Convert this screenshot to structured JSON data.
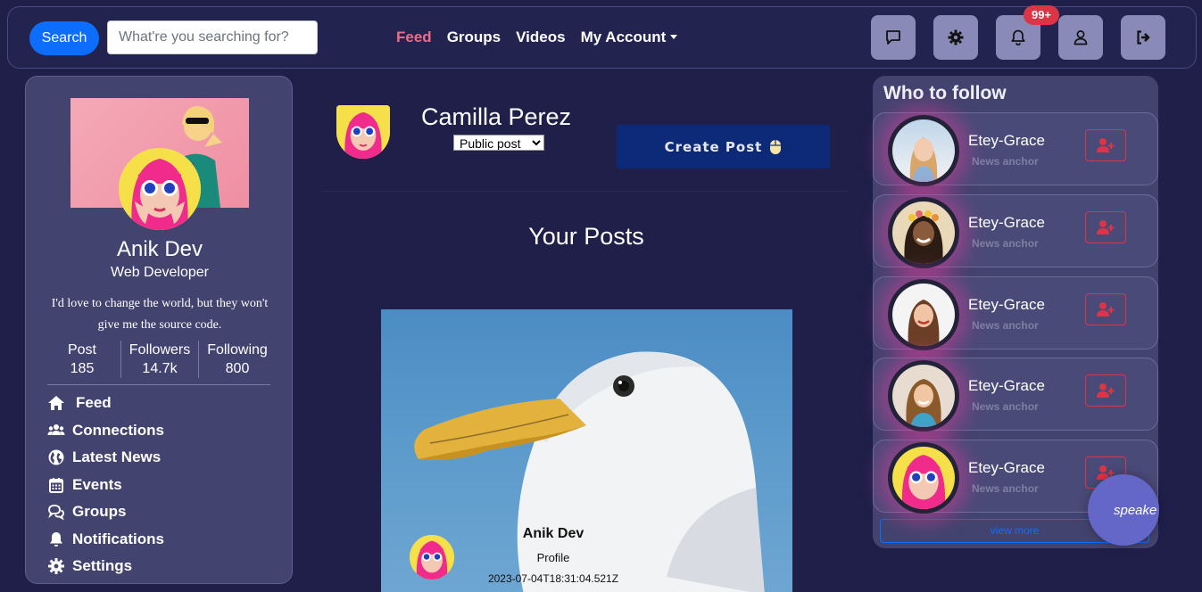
{
  "navbar": {
    "search_label": "Search",
    "search_placeholder": "What're you searching for?",
    "links": [
      "Feed",
      "Groups",
      "Videos",
      "My Account"
    ],
    "notification_badge": "99+",
    "icons": [
      "chat-icon",
      "gear-icon",
      "bell-icon",
      "user-icon",
      "logout-icon"
    ]
  },
  "profile": {
    "name": "Anik Dev",
    "role": "Web Developer",
    "bio": "I'd love to change the world, but they won't give me the source code.",
    "stats": [
      {
        "label": "Post",
        "value": "185"
      },
      {
        "label": "Followers",
        "value": "14.7k"
      },
      {
        "label": "Following",
        "value": "800"
      }
    ],
    "menu": [
      "Feed",
      "Connections",
      "Latest News",
      "Events",
      "Groups",
      "Notifications",
      "Settings"
    ]
  },
  "composer": {
    "name": "Camilla Perez",
    "privacy_selected": "Public post",
    "create_label": "Create Post"
  },
  "posts": {
    "title": "Your Posts",
    "items": [
      {
        "author": "Anik Dev",
        "profile_label": "Profile",
        "date": "2023-07-04T18:31:04.521Z"
      }
    ]
  },
  "follow": {
    "title": "Who to follow",
    "people": [
      {
        "name": "Etey-Grace",
        "subtitle": "News anchor"
      },
      {
        "name": "Etey-Grace",
        "subtitle": "News anchor"
      },
      {
        "name": "Etey-Grace",
        "subtitle": "News anchor"
      },
      {
        "name": "Etey-Grace",
        "subtitle": "News anchor"
      },
      {
        "name": "Etey-Grace",
        "subtitle": "News anchor"
      }
    ],
    "view_more": "view more"
  },
  "speak_button": "speake",
  "colors": {
    "background": "#1f1f4a",
    "panel": "#43436f",
    "primary": "#0d6efd",
    "active_link": "#f06b85",
    "danger": "#dc3545",
    "create_button": "#0c2a78"
  }
}
